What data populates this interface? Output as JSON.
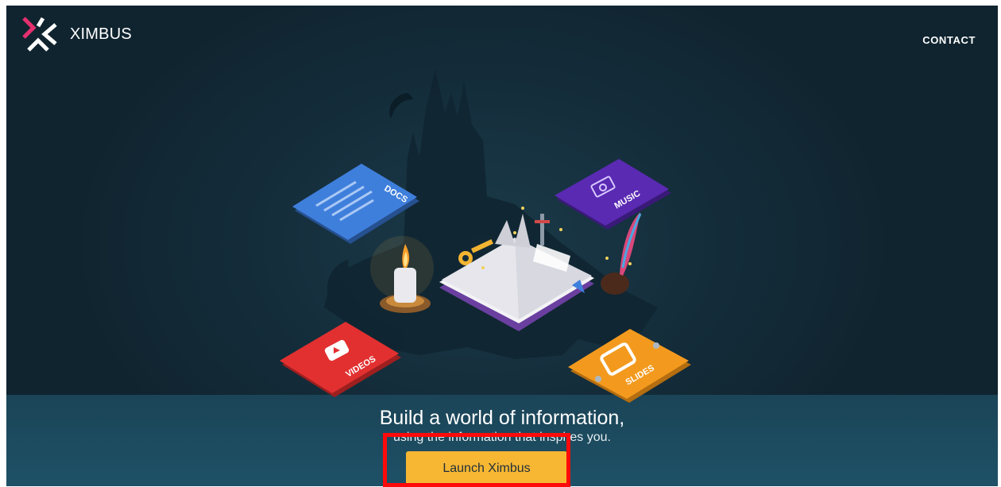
{
  "header": {
    "brand": "XIMBUS",
    "contact_label": "CONTACT"
  },
  "cards": {
    "docs": "DOCS",
    "music": "MUSIC",
    "videos": "VIDEOS",
    "slides": "SLIDES"
  },
  "hero": {
    "headline": "Build a world of information,",
    "subheadline": "using the information that inspires you.",
    "cta_label": "Launch Ximbus"
  },
  "colors": {
    "background": "#142d3b",
    "accent_pink": "#e5306f",
    "cta": "#f7b733",
    "highlight": "#ff0a0a",
    "docs": "#3f7fdc",
    "music": "#5a2ab3",
    "videos": "#e23030",
    "slides": "#f39a1e"
  },
  "icons": [
    "ximbus-logo-icon",
    "play-icon",
    "music-note-icon",
    "slides-icon"
  ]
}
